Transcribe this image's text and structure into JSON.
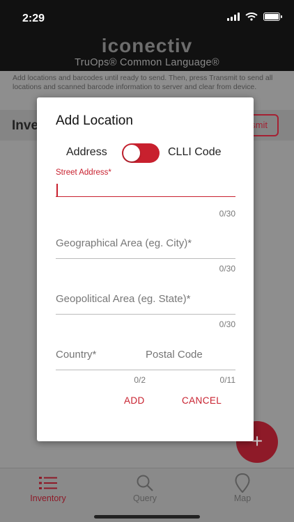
{
  "status_bar": {
    "time": "2:29"
  },
  "header": {
    "logo": "iconectiv",
    "app_name": "TruOps® Common Language®"
  },
  "instructions": "Add locations and barcodes until ready to send. Then, press Transmit to send all locations and scanned barcode information to server and clear from device.",
  "inventory": {
    "title": "Inventory",
    "transmit_label": "Transmit",
    "fab_label": "+"
  },
  "modal": {
    "title": "Add Location",
    "toggle_left": "Address",
    "toggle_right": "CLLI Code",
    "toggle_on": true,
    "street": {
      "label": "Street Address*",
      "value": "",
      "counter": "0/30"
    },
    "city": {
      "placeholder": "Geographical Area (eg. City)*",
      "counter": "0/30"
    },
    "state": {
      "placeholder": "Geopolitical Area (eg. State)*",
      "counter": "0/30"
    },
    "country": {
      "placeholder": "Country*",
      "counter": "0/2"
    },
    "postal": {
      "placeholder": "Postal Code",
      "counter": "0/11"
    },
    "add_label": "ADD",
    "cancel_label": "CANCEL"
  },
  "tabs": [
    {
      "label": "Inventory",
      "icon": "list-icon",
      "active": true
    },
    {
      "label": "Query",
      "icon": "search-icon",
      "active": false
    },
    {
      "label": "Map",
      "icon": "map-pin-icon",
      "active": false
    }
  ],
  "colors": {
    "accent": "#c8202e",
    "header": "#111111"
  }
}
